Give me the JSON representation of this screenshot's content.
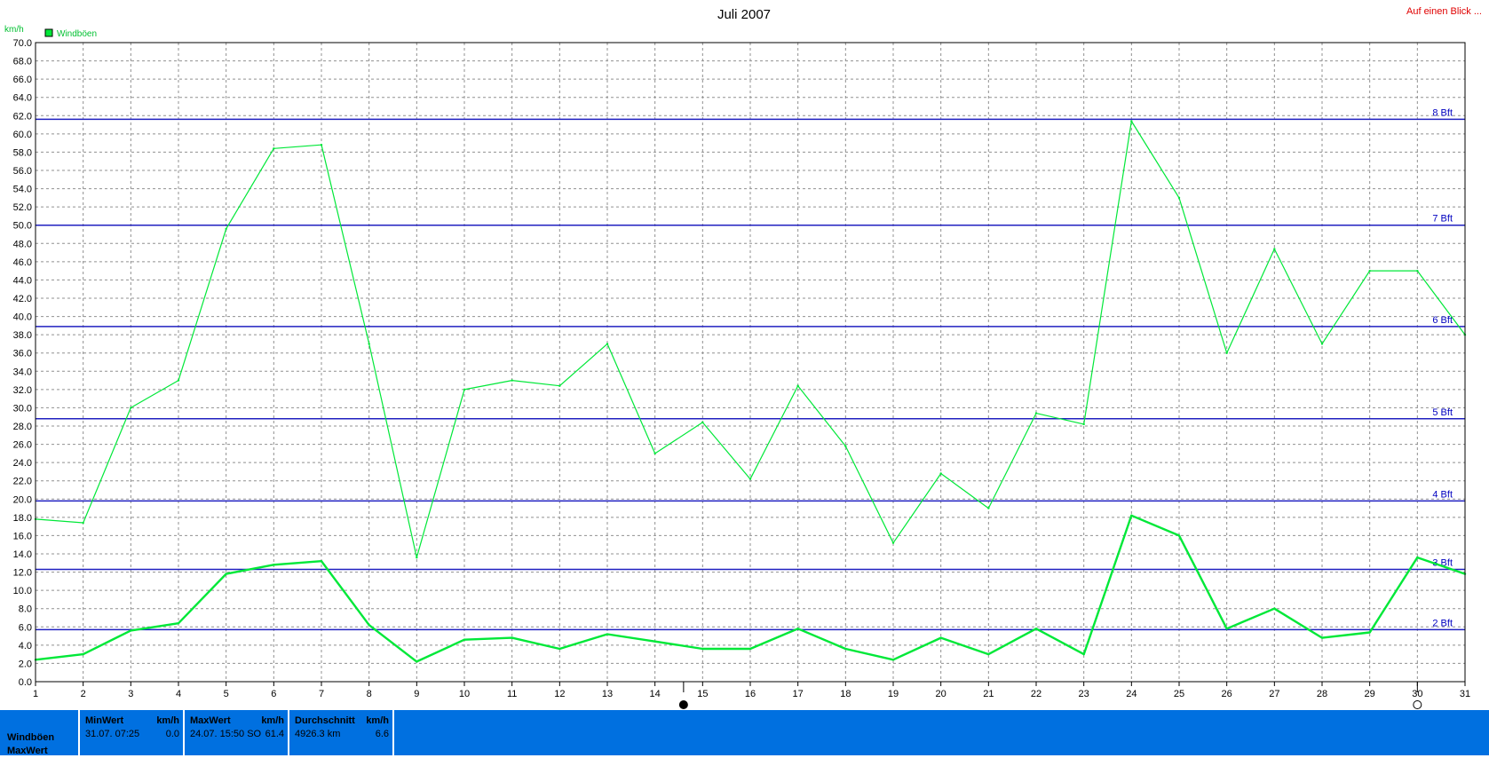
{
  "header": {
    "title": "Juli 2007",
    "link": "Auf einen Blick ..."
  },
  "colors": {
    "series": "#00e838",
    "bft_lines": "#2020c0",
    "bft_labels": "#0000c0",
    "grid": "#909090",
    "link": "#e00000",
    "stats_bg": "#0070e0"
  },
  "chart_data": {
    "type": "line",
    "title": "Juli 2007",
    "ylabel": "km/h",
    "ylim": [
      0,
      70
    ],
    "y_tick_step": 2,
    "xlim": [
      1,
      31
    ],
    "x": [
      1,
      2,
      3,
      4,
      5,
      6,
      7,
      8,
      9,
      10,
      11,
      12,
      13,
      14,
      15,
      16,
      17,
      18,
      19,
      20,
      21,
      22,
      23,
      24,
      25,
      26,
      27,
      28,
      29,
      30,
      31
    ],
    "series": [
      {
        "name": "Windböen",
        "role": "max",
        "values": [
          17.8,
          17.4,
          30.0,
          33.0,
          49.6,
          58.4,
          58.8,
          37.0,
          13.6,
          32.0,
          33.0,
          32.4,
          37.0,
          25.0,
          28.4,
          22.2,
          32.4,
          25.8,
          15.2,
          22.8,
          19.0,
          29.4,
          28.2,
          61.4,
          53.0,
          36.0,
          47.4,
          37.0,
          45.0,
          45.0,
          38.0
        ]
      },
      {
        "name": "",
        "role": "average",
        "values": [
          2.4,
          3.0,
          5.6,
          6.4,
          11.8,
          12.8,
          13.2,
          6.2,
          2.2,
          4.6,
          4.8,
          3.6,
          5.2,
          4.4,
          3.6,
          3.6,
          5.8,
          3.6,
          2.4,
          4.8,
          3.0,
          5.8,
          3.0,
          18.2,
          16.0,
          5.8,
          8.0,
          4.8,
          5.4,
          13.6,
          11.8
        ]
      }
    ],
    "reference_lines": [
      {
        "label": "2 Bft",
        "value": 5.7
      },
      {
        "label": "3 Bft",
        "value": 12.3
      },
      {
        "label": "4 Bft",
        "value": 19.8
      },
      {
        "label": "5 Bft",
        "value": 28.8
      },
      {
        "label": "6 Bft",
        "value": 38.9
      },
      {
        "label": "7 Bft",
        "value": 50.0
      },
      {
        "label": "8 Bft",
        "value": 61.6
      }
    ],
    "moon_markers": [
      {
        "x": 14.6,
        "type": "new-moon"
      },
      {
        "x": 30.0,
        "type": "full-moon"
      }
    ],
    "grid": true,
    "legend": "top-left"
  },
  "stats": {
    "row_labels": [
      "Windböen",
      "MaxWert"
    ],
    "min": {
      "label": "MinWert",
      "unit": "km/h",
      "date": "31.07.  07:25",
      "value": "0.0"
    },
    "max": {
      "label": "MaxWert",
      "unit": "km/h",
      "date": "24.07.  15:50 SO",
      "value": "61.4"
    },
    "avg": {
      "label": "Durchschnitt",
      "unit": "km/h",
      "date": "4926.3 km",
      "value": "6.6"
    }
  }
}
